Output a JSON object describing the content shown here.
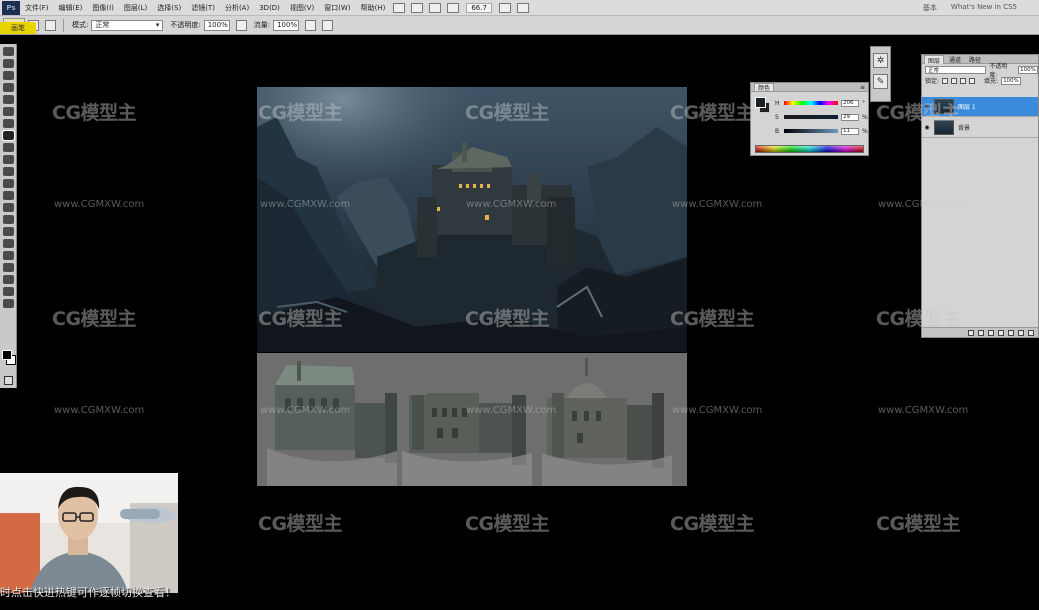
{
  "menubar": {
    "app_icon": "Ps",
    "items": [
      "文件(F)",
      "编辑(E)",
      "图像(I)",
      "图层(L)",
      "选择(S)",
      "滤镜(T)",
      "分析(A)",
      "3D(D)",
      "视图(V)",
      "窗口(W)",
      "帮助(H)"
    ],
    "zoom": "66.7",
    "right_items": [
      "基本",
      "What's New in CS5"
    ]
  },
  "options": {
    "tool_tag": "画笔",
    "mode_label": "模式:",
    "mode_value": "正常",
    "opacity_label": "不透明度:",
    "opacity_value": "100%",
    "flow_label": "流量:",
    "flow_value": "100%"
  },
  "color_panel": {
    "tabs": [
      "颜色"
    ],
    "rows": [
      {
        "channel": "H",
        "value": "206"
      },
      {
        "channel": "S",
        "value": "29"
      },
      {
        "channel": "B",
        "value": "11"
      }
    ],
    "units": [
      "°",
      "%",
      "%"
    ],
    "fg_color": "#1a1f24"
  },
  "layers_panel": {
    "tabs": [
      "图层",
      "通道",
      "路径"
    ],
    "blend_mode": "正常",
    "opacity_label": "不透明度:",
    "opacity_value": "100%",
    "lock_label": "锁定:",
    "fill_label": "填充:",
    "fill_value": "100%",
    "layers": [
      {
        "name": "图层 1",
        "active": true
      },
      {
        "name": "背景",
        "active": false
      }
    ]
  },
  "subtitle": "时点击快进热键可作逐帧切换查看！",
  "watermark": {
    "logo_text": "CG模型主",
    "url_text": "www.CGMXW.com"
  },
  "colors": {
    "accent": "#3b8bdb",
    "canvas_bg": "#000000",
    "panel_bg": "#d4d4d4",
    "tool_highlight": "#e8d400"
  }
}
